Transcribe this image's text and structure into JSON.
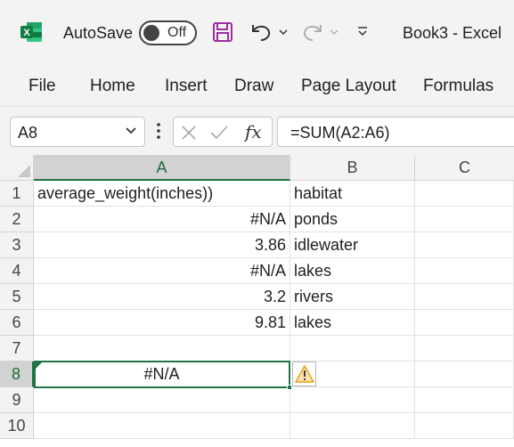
{
  "titlebar": {
    "autosave_label": "AutoSave",
    "autosave_state": "Off",
    "doc_title": "Book3  -  Excel",
    "icons": [
      "excel-logo-icon",
      "save-icon",
      "undo-icon",
      "redo-icon",
      "customize-toolbar-icon"
    ]
  },
  "ribbon": {
    "tabs": [
      "File",
      "Home",
      "Insert",
      "Draw",
      "Page Layout",
      "Formulas"
    ]
  },
  "formula_bar": {
    "name_box": "A8",
    "formula": "=SUM(A2:A6)",
    "fx_label": "fx"
  },
  "grid": {
    "columns": [
      "A",
      "B",
      "C"
    ],
    "rows": [
      "1",
      "2",
      "3",
      "4",
      "5",
      "6",
      "7",
      "8",
      "9",
      "10"
    ],
    "cells": {
      "A1": "average_weight(inches))",
      "B1": "habitat",
      "A2": "#N/A",
      "B2": "ponds",
      "A3": "3.86",
      "B3": "idlewater",
      "A4": "#N/A",
      "B4": "lakes",
      "A5": "3.2",
      "B5": "rivers",
      "A6": "9.81",
      "B6": "lakes",
      "A8": "#N/A"
    },
    "active_cell": "A8",
    "accent_color": "#217346",
    "warning_color": "#e8a317"
  }
}
